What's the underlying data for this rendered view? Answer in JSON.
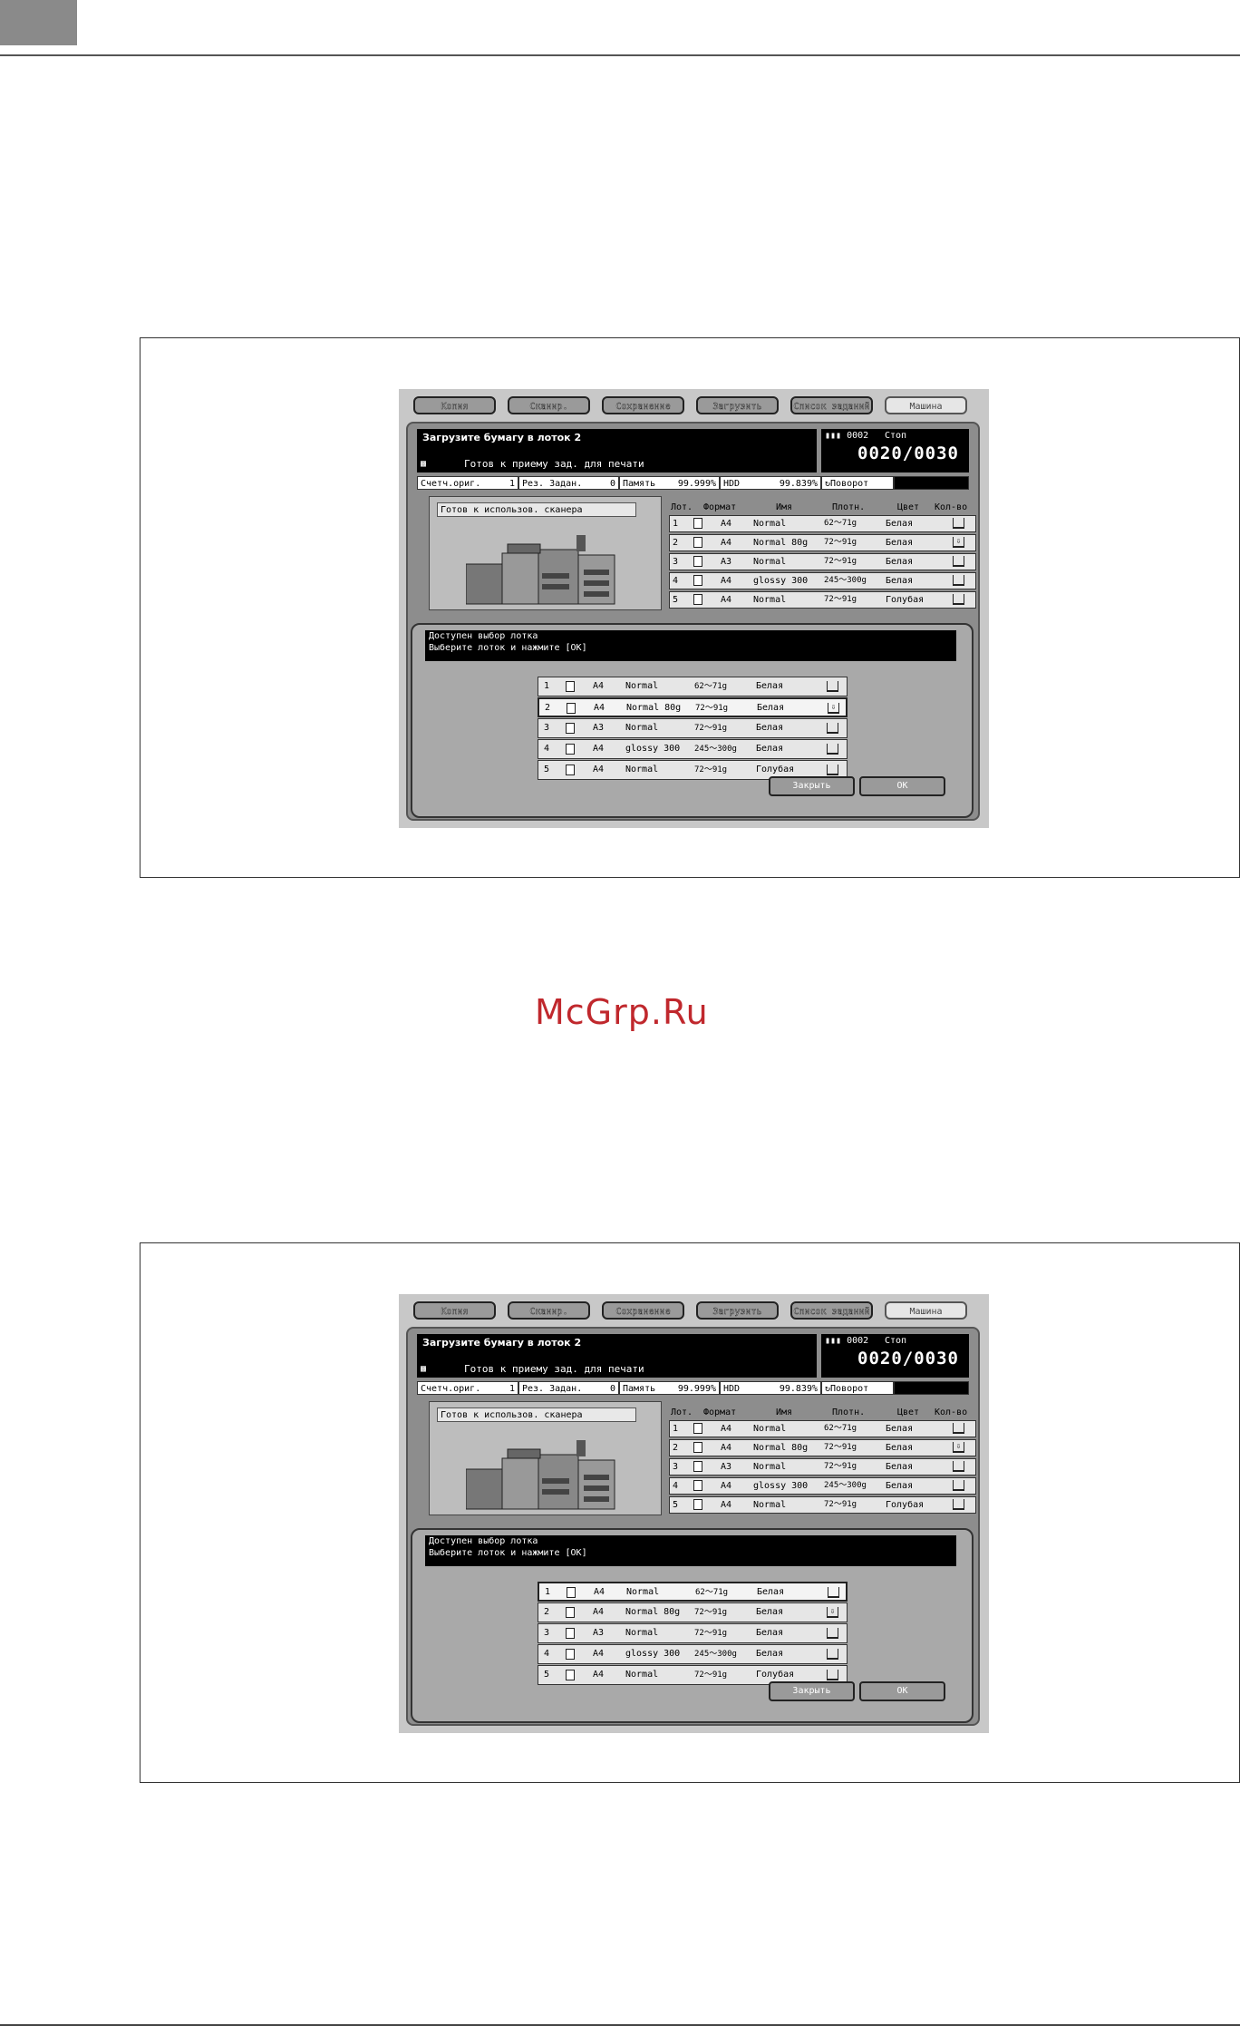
{
  "watermark": "McGrp.Ru",
  "screens": [
    {
      "tabs": [
        "Копия",
        "Сканир.",
        "Сохранение",
        "Загрузить",
        "Список заданий",
        "Машина"
      ],
      "active_tab": 5,
      "message": "Загрузите бумагу в лоток 2",
      "print_status": "Готов к приему зад. для печати",
      "counter_set": "0002",
      "counter_stop": "Стоп",
      "counter_value": "0020/0030",
      "status": {
        "orig_label": "Счетч.ориг.",
        "orig_value": "1",
        "res_label": "Рез. Задан.",
        "res_value": "0",
        "mem_label": "Память",
        "mem_value": "99.999%",
        "hdd_label": "HDD",
        "hdd_value": "99.839%",
        "rotation": "Поворот"
      },
      "scanner_status": "Готов к использов. сканера",
      "table_headers": [
        "Лот.",
        "Формат",
        "Имя",
        "Плотн.",
        "Цвет",
        "Кол-во"
      ],
      "trays": [
        {
          "num": "1",
          "size": "A4",
          "name": "Normal",
          "weight": "62～71g",
          "color": "Белая",
          "qty": "full"
        },
        {
          "num": "2",
          "size": "A4",
          "name": "Normal 80g",
          "weight": "72～91g",
          "color": "Белая",
          "qty": "low"
        },
        {
          "num": "3",
          "size": "A3",
          "name": "Normal",
          "weight": "72～91g",
          "color": "Белая",
          "qty": "full"
        },
        {
          "num": "4",
          "size": "A4",
          "name": "glossy 300",
          "weight": "245～300g",
          "color": "Белая",
          "qty": "full"
        },
        {
          "num": "5",
          "size": "A4",
          "name": "Normal",
          "weight": "72～91g",
          "color": "Голубая",
          "qty": "full"
        }
      ],
      "dialog_line1": "Доступен выбор лотка",
      "dialog_line2": "Выберите лоток и нажмите [OK]",
      "selected_row": 2,
      "close_label": "Закрыть",
      "ok_label": "OK"
    },
    {
      "tabs": [
        "Копия",
        "Сканир.",
        "Сохранение",
        "Загрузить",
        "Список заданий",
        "Машина"
      ],
      "active_tab": 5,
      "message": "Загрузите бумагу в лоток 2",
      "print_status": "Готов к приему зад. для печати",
      "counter_set": "0002",
      "counter_stop": "Стоп",
      "counter_value": "0020/0030",
      "status": {
        "orig_label": "Счетч.ориг.",
        "orig_value": "1",
        "res_label": "Рез. Задан.",
        "res_value": "0",
        "mem_label": "Память",
        "mem_value": "99.999%",
        "hdd_label": "HDD",
        "hdd_value": "99.839%",
        "rotation": "Поворот"
      },
      "scanner_status": "Готов к использов. сканера",
      "table_headers": [
        "Лот.",
        "Формат",
        "Имя",
        "Плотн.",
        "Цвет",
        "Кол-во"
      ],
      "trays": [
        {
          "num": "1",
          "size": "A4",
          "name": "Normal",
          "weight": "62～71g",
          "color": "Белая",
          "qty": "full"
        },
        {
          "num": "2",
          "size": "A4",
          "name": "Normal 80g",
          "weight": "72～91g",
          "color": "Белая",
          "qty": "low"
        },
        {
          "num": "3",
          "size": "A3",
          "name": "Normal",
          "weight": "72～91g",
          "color": "Белая",
          "qty": "full"
        },
        {
          "num": "4",
          "size": "A4",
          "name": "glossy 300",
          "weight": "245～300g",
          "color": "Белая",
          "qty": "full"
        },
        {
          "num": "5",
          "size": "A4",
          "name": "Normal",
          "weight": "72～91g",
          "color": "Голубая",
          "qty": "full"
        }
      ],
      "dialog_line1": "Доступен выбор лотка",
      "dialog_line2": "Выберите лоток и нажмите [OK]",
      "selected_row": 1,
      "close_label": "Закрыть",
      "ok_label": "OK"
    }
  ]
}
